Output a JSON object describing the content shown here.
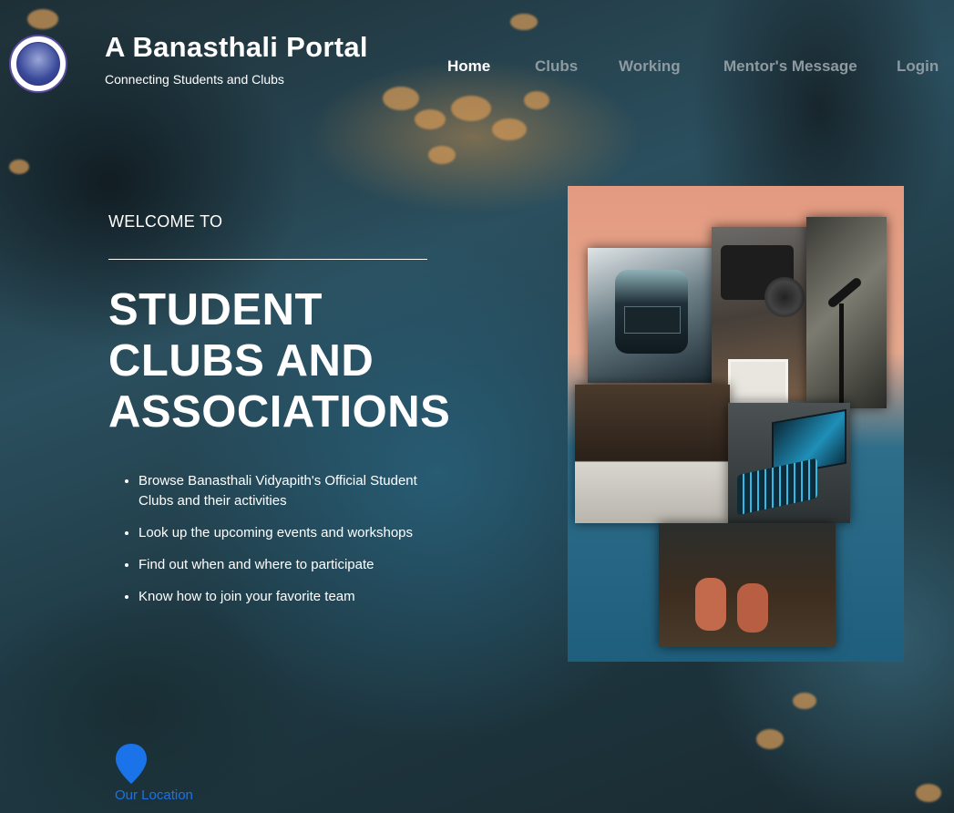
{
  "header": {
    "title": "A Banasthali Portal",
    "tagline": "Connecting Students and Clubs",
    "logo_icon": "university-seal-logo"
  },
  "nav": {
    "items": [
      {
        "label": "Home",
        "active": true
      },
      {
        "label": "Clubs",
        "active": false
      },
      {
        "label": "Working",
        "active": false
      },
      {
        "label": "Mentor's Message",
        "active": false
      },
      {
        "label": "Login",
        "active": false
      }
    ]
  },
  "hero": {
    "eyebrow": "WELCOME TO",
    "heading": "STUDENT CLUBS AND ASSOCIATIONS",
    "features": [
      "Browse Banasthali Vidyapith's Official Student Clubs and their activities",
      "Look up the upcoming events and workshops",
      "Find out when and where to participate",
      "Know how to join your favorite team"
    ]
  },
  "location": {
    "label": "Our Location",
    "icon": "map-pin-icon"
  },
  "colors": {
    "nav_active": "#ffffff",
    "nav_inactive": "#8e9aa0",
    "location_link": "#1a73e8"
  }
}
